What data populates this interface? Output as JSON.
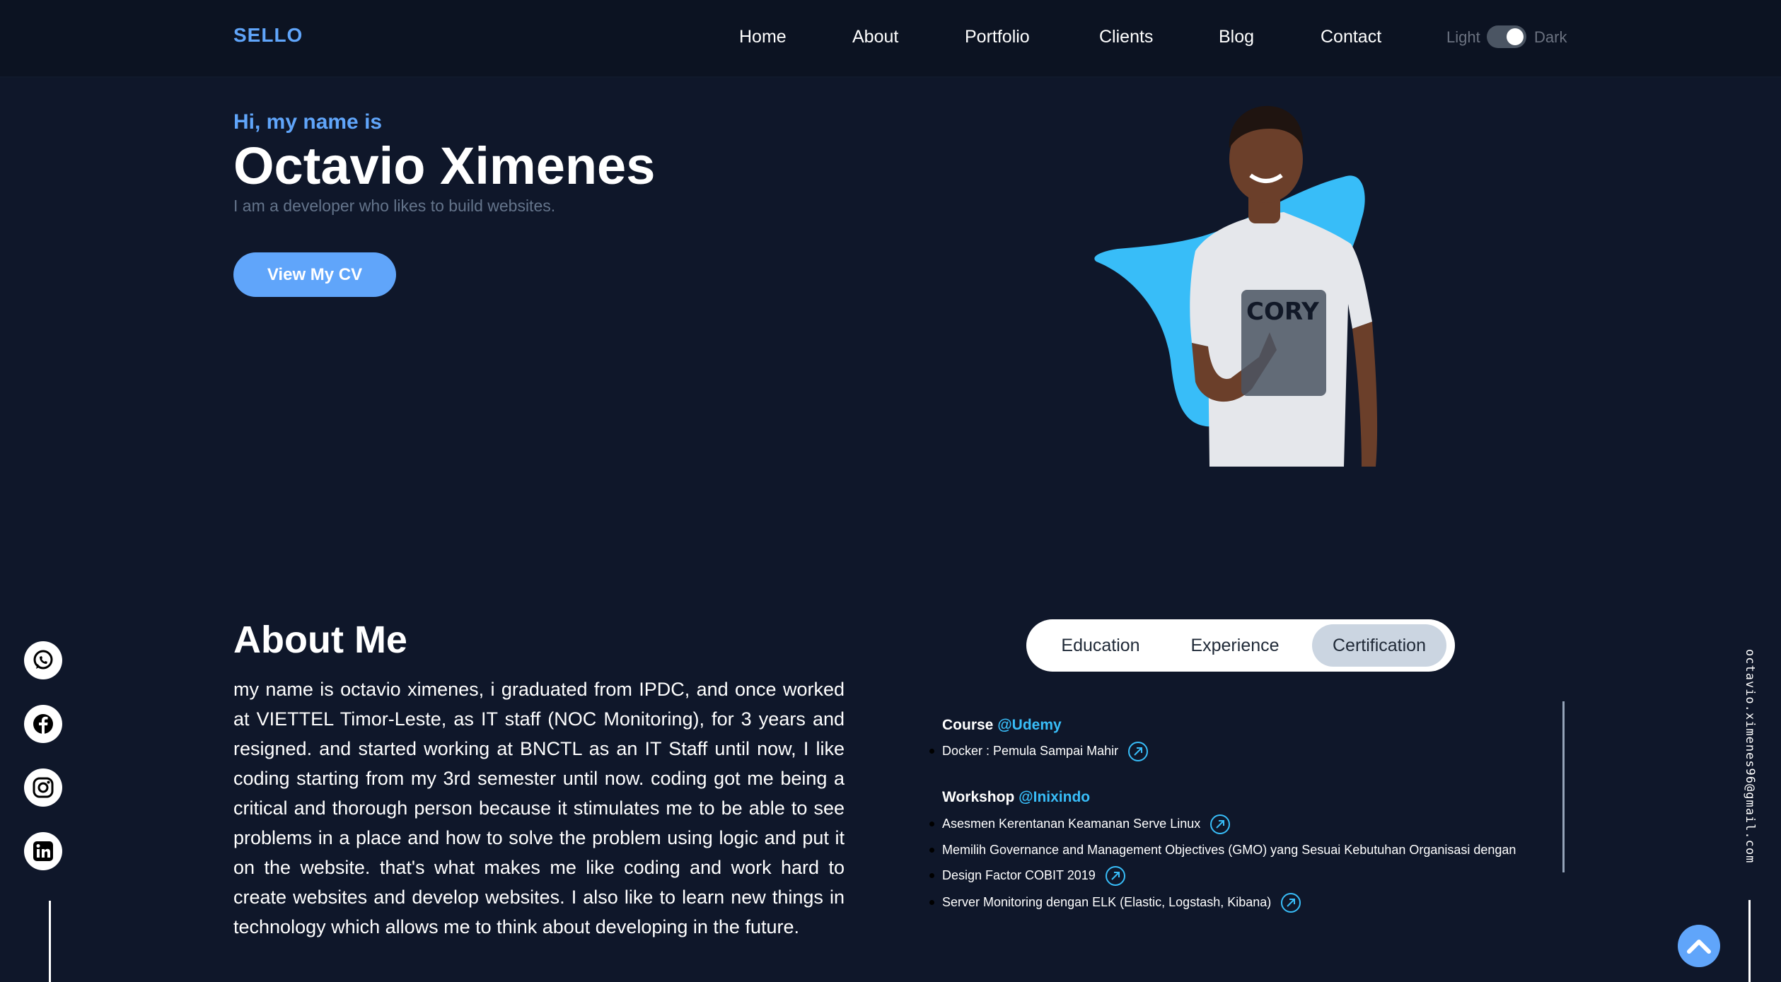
{
  "nav": {
    "logo": "SELLO",
    "links": [
      "Home",
      "About",
      "Portfolio",
      "Clients",
      "Blog",
      "Contact"
    ],
    "theme_light": "Light",
    "theme_dark": "Dark",
    "theme_mode": "Dark"
  },
  "hero": {
    "greeting": "Hi, my name is",
    "name": "Octavio Ximenes",
    "subtitle": "I am a developer who likes to build websites.",
    "cv_button": "View My CV"
  },
  "about": {
    "title": "About Me",
    "text": "my name is octavio ximenes, i graduated from IPDC, and once worked at VIETTEL Timor-Leste, as IT staff (NOC Monitoring), for 3 years and resigned. and started working at BNCTL as an IT Staff until now, I like coding starting from my 3rd semester until now. coding got me being a critical and thorough person because it stimulates me to be able to see problems in a place and how to solve the problem using logic and put it on the website. that's what makes me like coding and work hard to create websites and develop websites. I also like to learn new things in technology which allows me to think about developing in the future."
  },
  "tabs": {
    "items": [
      "Education",
      "Experience",
      "Certification"
    ],
    "active": "Certification"
  },
  "certification": {
    "course": {
      "label": "Course",
      "org": "@Udemy",
      "items": [
        "Docker : Pemula Sampai Mahir"
      ]
    },
    "workshop": {
      "label": "Workshop",
      "org": "@Inixindo",
      "items": [
        "Asesmen Kerentanan Keamanan Serve Linux",
        "Memilih Governance and Management Objectives (GMO) yang Sesuai Kebutuhan Organisasi dengan",
        "Design Factor COBIT 2019",
        "Server Monitoring dengan ELK (Elastic, Logstash, Kibana)"
      ]
    }
  },
  "side": {
    "email": "octavio.ximenes96@gmail.com",
    "socials": [
      "whatsapp-icon",
      "facebook-icon",
      "instagram-icon",
      "linkedin-icon"
    ]
  },
  "colors": {
    "background": "#0f172a",
    "accent": "#60a5fa",
    "link": "#38bdf8",
    "blob": "#38bdf8"
  }
}
